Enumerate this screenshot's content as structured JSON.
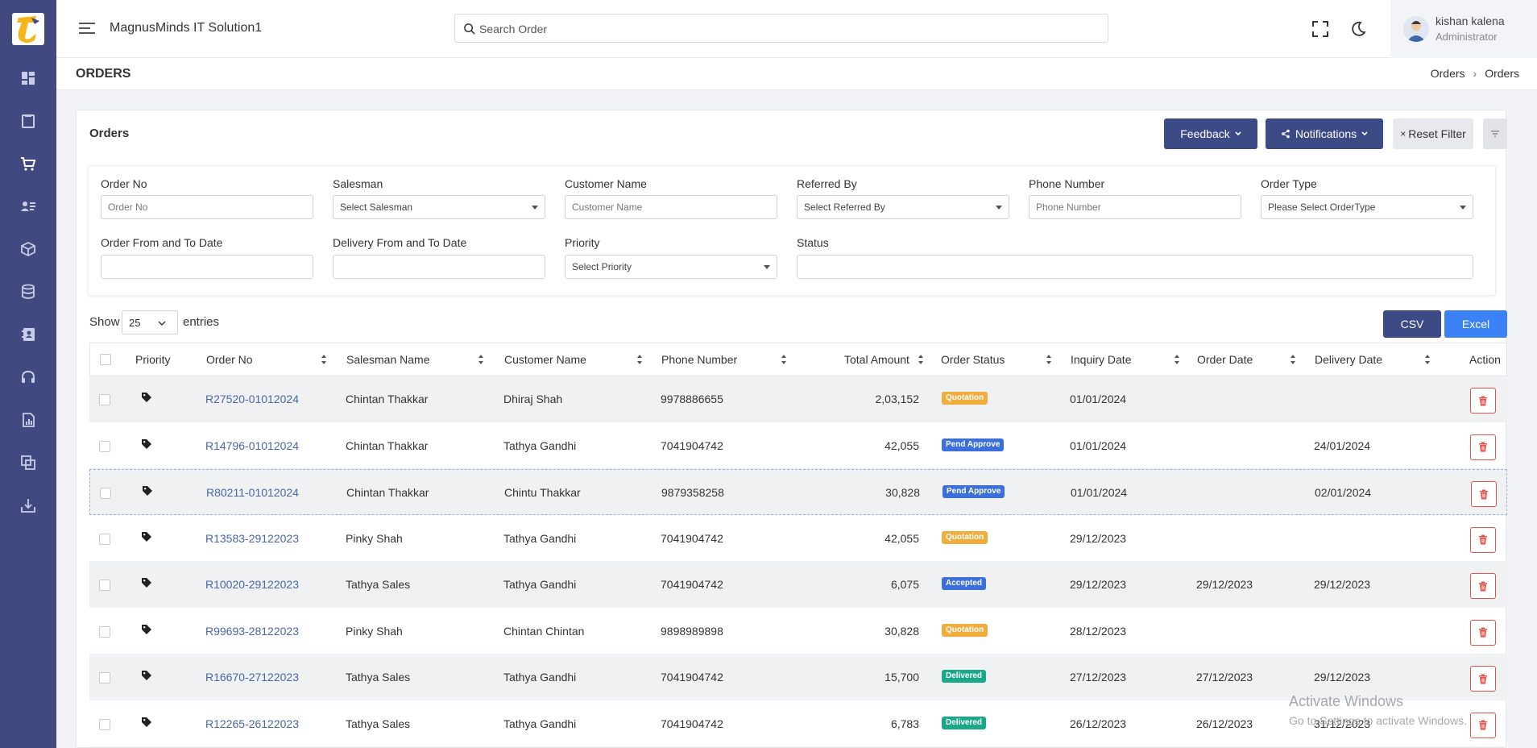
{
  "app": {
    "company": "MagnusMinds IT Solution1"
  },
  "search": {
    "placeholder": "Search Order"
  },
  "user": {
    "name": "kishan kalena",
    "role": "Administrator"
  },
  "page": {
    "title": "ORDERS",
    "breadcrumb": [
      "Orders",
      "Orders"
    ]
  },
  "sidebar": {
    "icons": [
      "dashboard-icon",
      "clipboard-icon",
      "cart-icon",
      "contacts-icon",
      "box-icon",
      "database-icon",
      "address-book-icon",
      "headset-icon",
      "report-icon",
      "copy-icon",
      "download-icon"
    ]
  },
  "card": {
    "title": "Orders",
    "feedback_label": "Feedback",
    "notifications_label": "Notifications",
    "reset_label": "Reset Filter"
  },
  "filters": {
    "order_no": {
      "label": "Order No",
      "placeholder": "Order No"
    },
    "salesman": {
      "label": "Salesman",
      "placeholder": "Select Salesman"
    },
    "customer": {
      "label": "Customer Name",
      "placeholder": "Customer Name"
    },
    "referred": {
      "label": "Referred By",
      "placeholder": "Select Referred By"
    },
    "phone": {
      "label": "Phone Number",
      "placeholder": "Phone Number"
    },
    "order_type": {
      "label": "Order Type",
      "placeholder": "Please Select OrderType"
    },
    "order_date": {
      "label": "Order From and To Date",
      "placeholder": ""
    },
    "delivery_date": {
      "label": "Delivery From and To Date",
      "placeholder": ""
    },
    "priority": {
      "label": "Priority",
      "placeholder": "Select Priority"
    },
    "status": {
      "label": "Status",
      "placeholder": ""
    }
  },
  "entries": {
    "show": "Show",
    "value": "25",
    "label": "entries"
  },
  "export": {
    "csv": "CSV",
    "excel": "Excel"
  },
  "table": {
    "headers": [
      "Priority",
      "Order No",
      "Salesman Name",
      "Customer Name",
      "Phone Number",
      "Total Amount",
      "Order Status",
      "Inquiry Date",
      "Order Date",
      "Delivery Date",
      "Action"
    ],
    "rows": [
      {
        "order_no": "R27520-01012024",
        "salesman": "Chintan Thakkar",
        "customer": "Dhiraj Shah",
        "phone": "9978886655",
        "amount": "2,03,152",
        "status": "Quotation",
        "status_color": "#f0ad3c",
        "inquiry": "01/01/2024",
        "order_date": "",
        "delivery": ""
      },
      {
        "order_no": "R14796-01012024",
        "salesman": "Chintan Thakkar",
        "customer": "Tathya Gandhi",
        "phone": "7041904742",
        "amount": "42,055",
        "status": "Pend Approve",
        "status_color": "#3b6fd9",
        "inquiry": "01/01/2024",
        "order_date": "",
        "delivery": "24/01/2024"
      },
      {
        "order_no": "R80211-01012024",
        "salesman": "Chintan Thakkar",
        "customer": "Chintu Thakkar",
        "phone": "9879358258",
        "amount": "30,828",
        "status": "Pend Approve",
        "status_color": "#3b6fd9",
        "inquiry": "01/01/2024",
        "order_date": "",
        "delivery": "02/01/2024"
      },
      {
        "order_no": "R13583-29122023",
        "salesman": "Pinky Shah",
        "customer": "Tathya Gandhi",
        "phone": "7041904742",
        "amount": "42,055",
        "status": "Quotation",
        "status_color": "#f0ad3c",
        "inquiry": "29/12/2023",
        "order_date": "",
        "delivery": ""
      },
      {
        "order_no": "R10020-29122023",
        "salesman": "Tathya Sales",
        "customer": "Tathya Gandhi",
        "phone": "7041904742",
        "amount": "6,075",
        "status": "Accepted",
        "status_color": "#3b6fd9",
        "inquiry": "29/12/2023",
        "order_date": "29/12/2023",
        "delivery": "29/12/2023"
      },
      {
        "order_no": "R99693-28122023",
        "salesman": "Pinky Shah",
        "customer": "Chintan Chintan",
        "phone": "9898989898",
        "amount": "30,828",
        "status": "Quotation",
        "status_color": "#f0ad3c",
        "inquiry": "28/12/2023",
        "order_date": "",
        "delivery": ""
      },
      {
        "order_no": "R16670-27122023",
        "salesman": "Tathya Sales",
        "customer": "Tathya Gandhi",
        "phone": "7041904742",
        "amount": "15,700",
        "status": "Delivered",
        "status_color": "#1aa88a",
        "inquiry": "27/12/2023",
        "order_date": "27/12/2023",
        "delivery": "29/12/2023"
      },
      {
        "order_no": "R12265-26122023",
        "salesman": "Tathya Sales",
        "customer": "Tathya Gandhi",
        "phone": "7041904742",
        "amount": "6,783",
        "status": "Delivered",
        "status_color": "#1aa88a",
        "inquiry": "26/12/2023",
        "order_date": "26/12/2023",
        "delivery": "31/12/2023"
      }
    ]
  },
  "watermark": {
    "title": "Activate Windows",
    "subtitle": "Go to Settings to activate Windows."
  }
}
